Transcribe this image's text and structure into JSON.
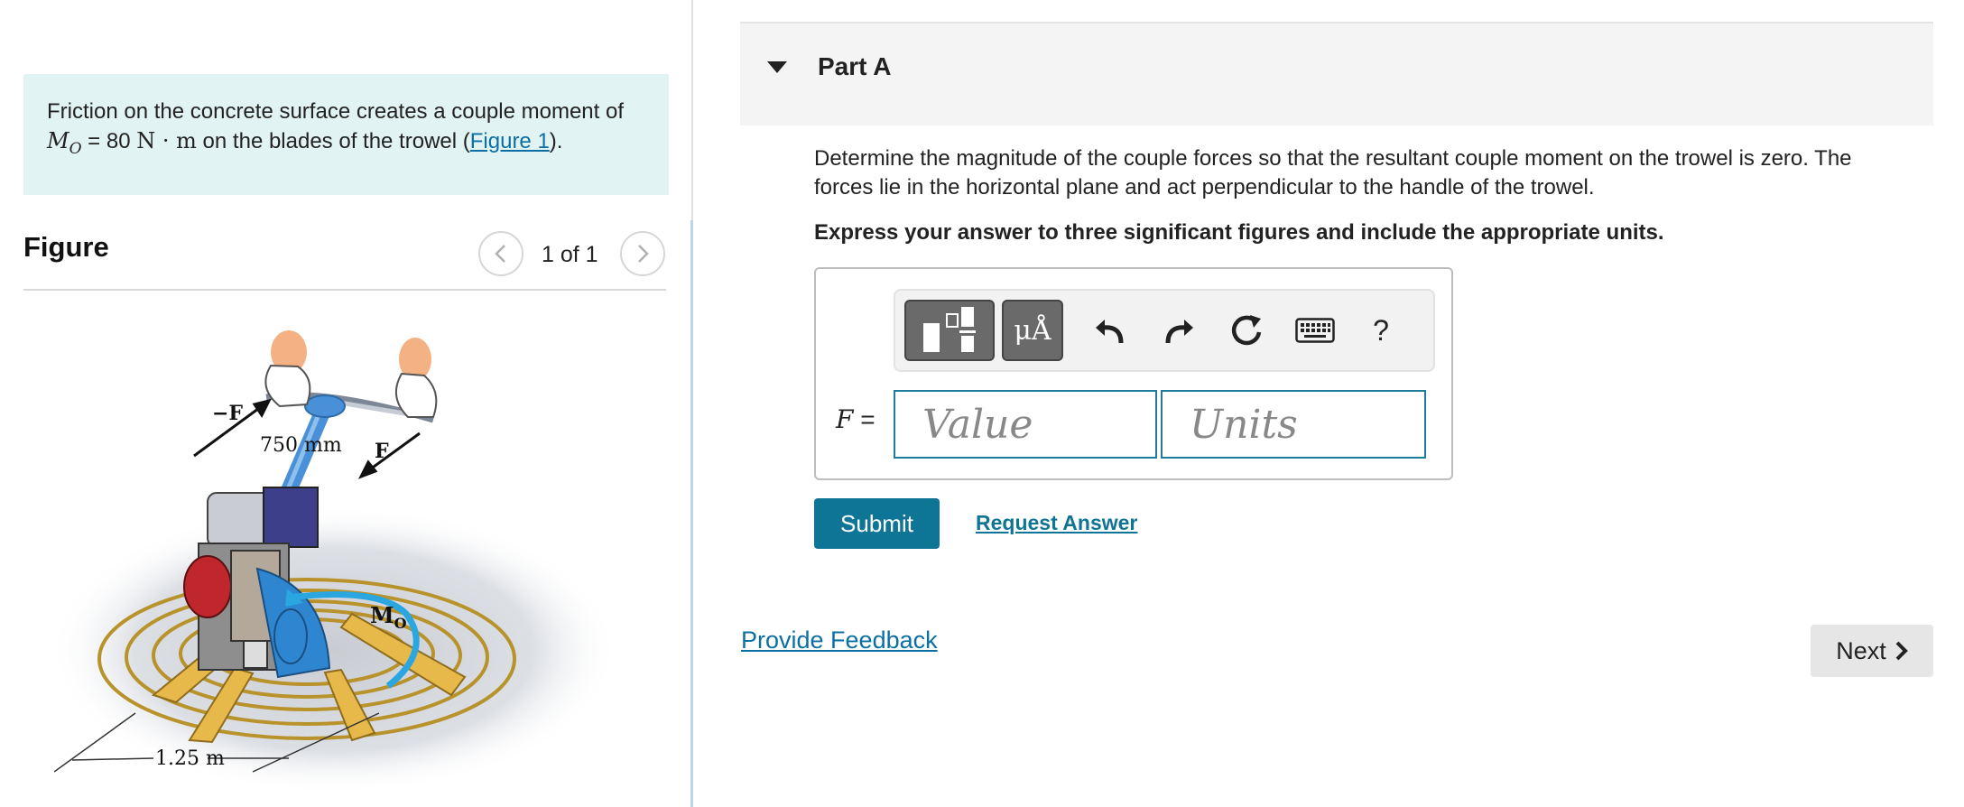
{
  "intro": {
    "text_before": "Friction on the concrete surface creates a couple moment of ",
    "moment_symbol": "M",
    "moment_subscript": "O",
    "equals_value": " = 80 ",
    "unit": "N · m",
    "text_after": " on the blades of the trowel (",
    "figure_link": "Figure 1",
    "text_end": ")."
  },
  "figure": {
    "heading": "Figure",
    "counter": "1 of 1",
    "prev_icon": "chevron-left-icon",
    "next_icon": "chevron-right-icon",
    "labels": {
      "neg_force": "−F",
      "dimension_handle": "750 mm",
      "force": "F",
      "moment": "M",
      "moment_sub": "O",
      "dimension_base": "1.25 m"
    }
  },
  "part": {
    "title": "Part A",
    "question": "Determine the magnitude of the couple forces so that the resultant couple moment on the trowel is zero. The forces lie in the horizontal plane and act perpendicular to the handle of the trowel.",
    "instruction": "Express your answer to three significant figures and include the appropriate units.",
    "toolbar": {
      "templates_icon": "templates-icon",
      "symbols_label": "μÅ",
      "undo_icon": "undo-icon",
      "redo_icon": "redo-icon",
      "reset_icon": "reset-icon",
      "keyboard_icon": "keyboard-icon",
      "help_label": "?"
    },
    "variable": "F",
    "equals": " =",
    "value_placeholder": "Value",
    "units_placeholder": "Units",
    "submit_label": "Submit",
    "request_answer_label": "Request Answer"
  },
  "footer": {
    "feedback_label": "Provide Feedback",
    "next_label": "Next"
  },
  "colors": {
    "accent": "#0f7597",
    "intro_bg": "#e2f3f3",
    "moment_arrow": "#2aa6e0",
    "handle": "#4a90d9"
  }
}
